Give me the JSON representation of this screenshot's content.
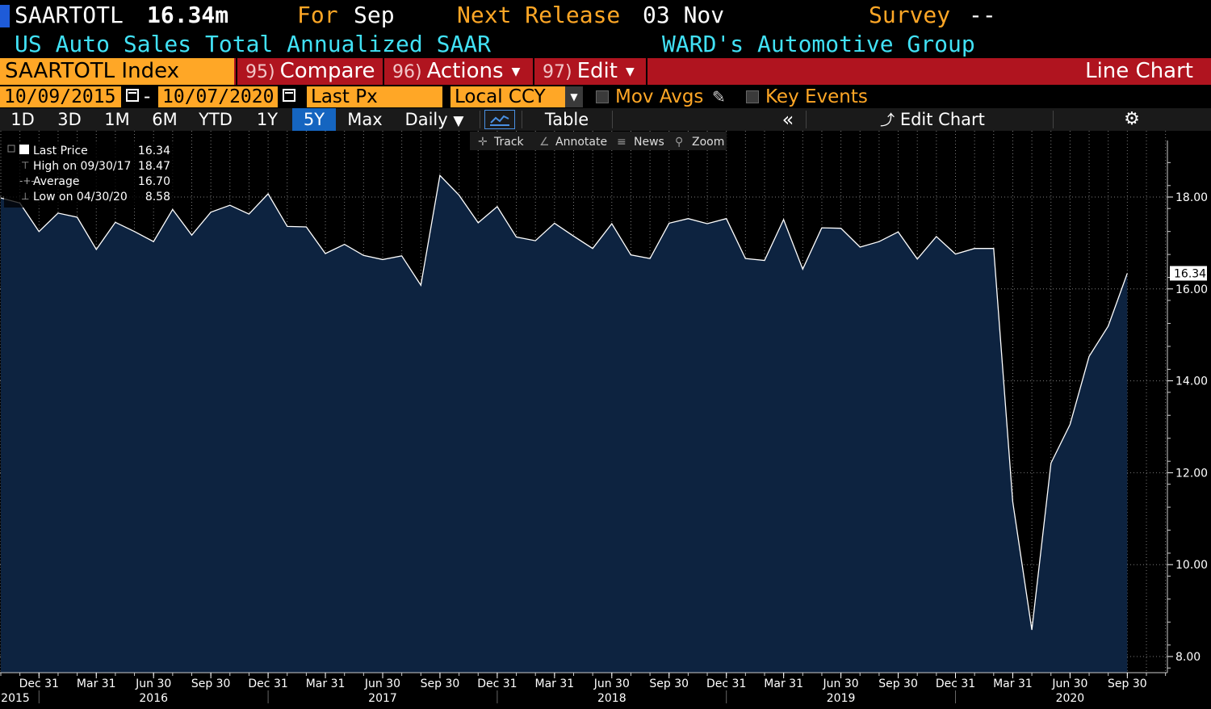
{
  "header": {
    "ticker": "SAARTOTL",
    "last_value": "16.34m",
    "for_label": "For",
    "for_value": "Sep",
    "next_release_label": "Next Release",
    "next_release_value": "03 Nov",
    "survey_label": "Survey",
    "survey_value": "--",
    "description": "US Auto Sales Total Annualized SAAR",
    "source": "WARD's Automotive Group"
  },
  "toolbar": {
    "index_label": "SAARTOTL Index",
    "compare": {
      "num": "95)",
      "label": "Compare"
    },
    "actions": {
      "num": "96)",
      "label": "Actions"
    },
    "edit": {
      "num": "97)",
      "label": "Edit"
    },
    "chart_type": "Line Chart"
  },
  "controls": {
    "start_date": "10/09/2015",
    "end_date": "10/07/2020",
    "dash": "-",
    "field": "Last Px",
    "currency": "Local CCY",
    "mov_avgs": "Mov Avgs",
    "key_events": "Key Events"
  },
  "range_buttons": [
    "1D",
    "3D",
    "1M",
    "6M",
    "YTD",
    "1Y",
    "5Y",
    "Max"
  ],
  "active_range": "5Y",
  "periodicity": "Daily",
  "table_label": "Table",
  "edit_chart_label": "Edit Chart",
  "chart_tools": [
    "Track",
    "Annotate",
    "News",
    "Zoom"
  ],
  "legend": {
    "rows": [
      {
        "label": "Last Price",
        "value": "16.34"
      },
      {
        "label": "High on 09/30/17",
        "value": "18.47"
      },
      {
        "label": "Average",
        "value": "16.70"
      },
      {
        "label": "Low on 04/30/20",
        "value": "8.58"
      }
    ]
  },
  "colors": {
    "area_fill": "#0d2340",
    "line": "#ffffff",
    "grid": "#7a7a7a",
    "accent_orange": "#ffa726",
    "accent_cyan": "#41e1f5",
    "bar_red": "#b0141f"
  },
  "chart_data": {
    "type": "area",
    "title": "",
    "xlabel": "",
    "ylabel": "",
    "ylim": [
      7.7,
      19.3
    ],
    "y_ticks": [
      "8.00",
      "10.00",
      "12.00",
      "14.00",
      "16.00",
      "18.00"
    ],
    "last_value_label": "16.34",
    "x_tick_labels": [
      "Dec 31",
      "Mar 31",
      "Jun 30",
      "Sep 30",
      "Dec 31",
      "Mar 31",
      "Jun 30",
      "Sep 30",
      "Dec 31",
      "Mar 31",
      "Jun 30",
      "Sep 30",
      "Dec 31",
      "Mar 31",
      "Jun 30",
      "Sep 30",
      "Dec 31",
      "Mar 31",
      "Jun 30",
      "Sep 30"
    ],
    "x_year_labels": [
      "2015",
      "2016",
      "2017",
      "2018",
      "2019",
      "2020"
    ],
    "series": [
      {
        "name": "Last Price",
        "x": [
          "2015-10",
          "2015-11",
          "2015-12",
          "2016-01",
          "2016-02",
          "2016-03",
          "2016-04",
          "2016-05",
          "2016-06",
          "2016-07",
          "2016-08",
          "2016-09",
          "2016-10",
          "2016-11",
          "2016-12",
          "2017-01",
          "2017-02",
          "2017-03",
          "2017-04",
          "2017-05",
          "2017-06",
          "2017-07",
          "2017-08",
          "2017-09",
          "2017-10",
          "2017-11",
          "2017-12",
          "2018-01",
          "2018-02",
          "2018-03",
          "2018-04",
          "2018-05",
          "2018-06",
          "2018-07",
          "2018-08",
          "2018-09",
          "2018-10",
          "2018-11",
          "2018-12",
          "2019-01",
          "2019-02",
          "2019-03",
          "2019-04",
          "2019-05",
          "2019-06",
          "2019-07",
          "2019-08",
          "2019-09",
          "2019-10",
          "2019-11",
          "2019-12",
          "2020-01",
          "2020-02",
          "2020-03",
          "2020-04",
          "2020-05",
          "2020-06",
          "2020-07",
          "2020-08",
          "2020-09"
        ],
        "values": [
          17.98,
          17.87,
          17.25,
          17.65,
          17.56,
          16.86,
          17.45,
          17.25,
          17.03,
          17.73,
          17.17,
          17.67,
          17.82,
          17.63,
          18.07,
          17.36,
          17.35,
          16.77,
          16.97,
          16.73,
          16.64,
          16.72,
          16.08,
          18.47,
          18.04,
          17.44,
          17.79,
          17.13,
          17.05,
          17.43,
          17.15,
          16.88,
          17.42,
          16.74,
          16.66,
          17.43,
          17.53,
          17.42,
          17.53,
          16.66,
          16.62,
          17.51,
          16.43,
          17.33,
          17.32,
          16.91,
          17.03,
          17.24,
          16.65,
          17.14,
          16.76,
          16.88,
          16.88,
          11.37,
          8.58,
          12.21,
          13.05,
          14.53,
          15.19,
          16.34
        ]
      }
    ],
    "grid": true,
    "legend_position": "top-left"
  }
}
